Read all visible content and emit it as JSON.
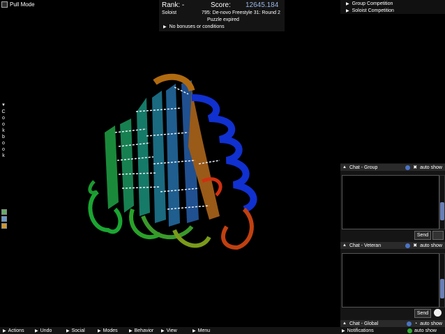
{
  "pull_mode": {
    "label": "Pull Mode"
  },
  "score_panel": {
    "rank_label": "Rank: -",
    "score_label": "Score:",
    "score_value": "12645.184",
    "role": "Soloist",
    "puzzle": "795: De-novo Freestyle 31: Round 2",
    "status": "Puzzle expired",
    "bonus": "No bonuses or conditions"
  },
  "competitions": [
    {
      "label": "Group Competition"
    },
    {
      "label": "Soloist Competition"
    }
  ],
  "cookbook": {
    "label": "Cookbook"
  },
  "chat": {
    "group": {
      "title": "Chat - Group",
      "auto_show": "auto show",
      "send": "Send"
    },
    "veteran": {
      "title": "Chat - Veteran",
      "auto_show": "auto show",
      "send": "Send"
    },
    "global": {
      "title": "Chat - Global",
      "auto_show": "auto show"
    },
    "notifications": {
      "title": "Notifications",
      "auto_show": "auto show"
    }
  },
  "bottom_menu": {
    "items": [
      "Actions",
      "Undo",
      "Social",
      "Modes",
      "Behavior",
      "View",
      "Menu"
    ]
  },
  "icons": {
    "expand": "triangle-right-icon",
    "collapse": "triangle-up-icon",
    "info": "info-icon",
    "close": "close-x-icon",
    "camera": "camera-icon",
    "clock": "clock-icon"
  },
  "colors": {
    "score_value": "#9bb7e6",
    "scroll_thumb": "#6a7fb5"
  }
}
